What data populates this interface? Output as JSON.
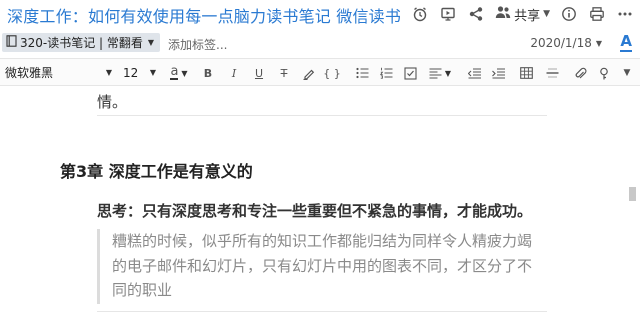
{
  "window": {
    "title": "深度工作：如何有效使用每一点脑力读书笔记 微信读书",
    "share_label": "共享"
  },
  "meta": {
    "notebook": "320-读书笔记 | 常翻看",
    "add_tag_placeholder": "添加标签...",
    "date": "2020/1/18",
    "font_size_icon": "A"
  },
  "toolbar": {
    "font_family": "微软雅黑",
    "font_size": "12",
    "text_color_icon": "a",
    "bold": "B",
    "italic": "I",
    "underline": "U",
    "strikethrough": "T",
    "code": "{ }"
  },
  "content": {
    "prev_tail": "情。",
    "chapter_heading": "第3章 深度工作是有意义的",
    "thought": "思考：只有深度思考和专注一些重要但不紧急的事情，才能成功。",
    "quote_lines": [
      "糟糕的时候，似乎所有的知识工作都能归结为同样令人精疲力竭",
      "的电子邮件和幻灯片，只有幻灯片中用的图表不同，才区分了不",
      "同的职业"
    ]
  },
  "colors": {
    "accent": "#2a7ad2",
    "quote_text": "#8a8a8a"
  }
}
